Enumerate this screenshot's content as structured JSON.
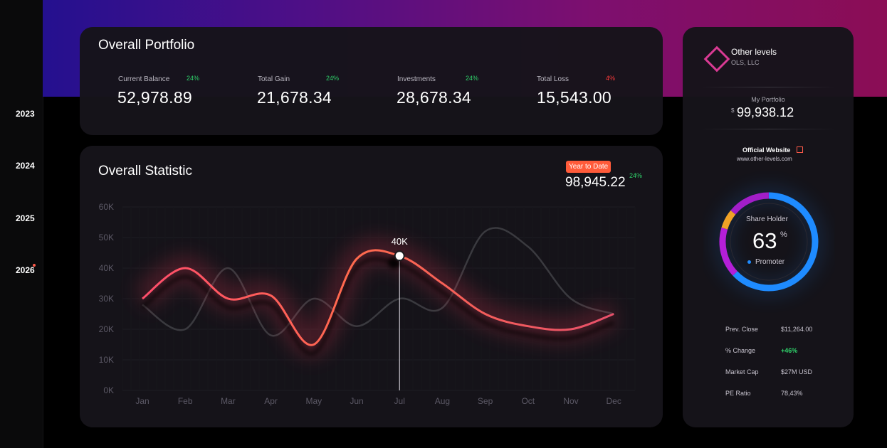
{
  "timeline": {
    "years": [
      "2023",
      "2024",
      "2025",
      "2026"
    ],
    "active_year": "2026"
  },
  "portfolio_card": {
    "title": "Overall Portfolio",
    "stats": [
      {
        "label": "Current Balance",
        "badge": "24%",
        "value": "52,978.89",
        "trend": "up"
      },
      {
        "label": "Total Gain",
        "badge": "24%",
        "value": "21,678.34",
        "trend": "up"
      },
      {
        "label": "Investments",
        "badge": "24%",
        "value": "28,678.34",
        "trend": "up"
      },
      {
        "label": "Total Loss",
        "badge": "4%",
        "value": "15,543.00",
        "trend": "down"
      }
    ]
  },
  "statistic_card": {
    "title": "Overall Statistic",
    "ytd_label": "Year to Date",
    "ytd_value": "98,945.22",
    "ytd_badge": "24%",
    "tooltip": "40K"
  },
  "chart_data": {
    "type": "line",
    "categories": [
      "Jan",
      "Feb",
      "Mar",
      "Apr",
      "May",
      "Jun",
      "Jul",
      "Aug",
      "Sep",
      "Oct",
      "Nov",
      "Dec"
    ],
    "y_ticks": [
      "0K",
      "10K",
      "20K",
      "30K",
      "40K",
      "50K",
      "60K"
    ],
    "ylim": [
      0,
      60
    ],
    "grid": true,
    "series": [
      {
        "values": [
          30,
          40,
          30,
          31,
          15,
          43,
          44,
          35,
          25,
          21,
          20,
          25
        ],
        "color": "#ff6a4d"
      },
      {
        "values": [
          28,
          20,
          40,
          18,
          30,
          21,
          30,
          27,
          52,
          47,
          30,
          25
        ],
        "color": "#3a3a3f"
      }
    ],
    "highlight": {
      "category": "Jul",
      "value": 44,
      "label": "40K"
    }
  },
  "side_card": {
    "company_name": "Other levels",
    "company_sub": "OLS, LLC",
    "portfolio_label": "My Portfolio",
    "portfolio_currency": "$",
    "portfolio_value": "99,938.12",
    "website_label": "Official Website",
    "website_url": "www.other-levels.com",
    "donut": {
      "title": "Share Holder",
      "value": "63",
      "unit": "%",
      "legend": "Promoter",
      "fraction": 0.63
    },
    "details": [
      {
        "label": "Prev. Close",
        "value": "$11,264.00",
        "accent": false
      },
      {
        "label": "% Change",
        "value": "+46%",
        "accent": true
      },
      {
        "label": "Market Cap",
        "value": "$27M USD",
        "accent": false
      },
      {
        "label": "PE Ratio",
        "value": "78,43%",
        "accent": false
      }
    ]
  },
  "colors": {
    "accent_orange": "#ff5b3a",
    "positive": "#2fd16a",
    "negative": "#ff3b3b",
    "brand_pink": "#d93a93",
    "donut_blue": "#1e8bff"
  }
}
